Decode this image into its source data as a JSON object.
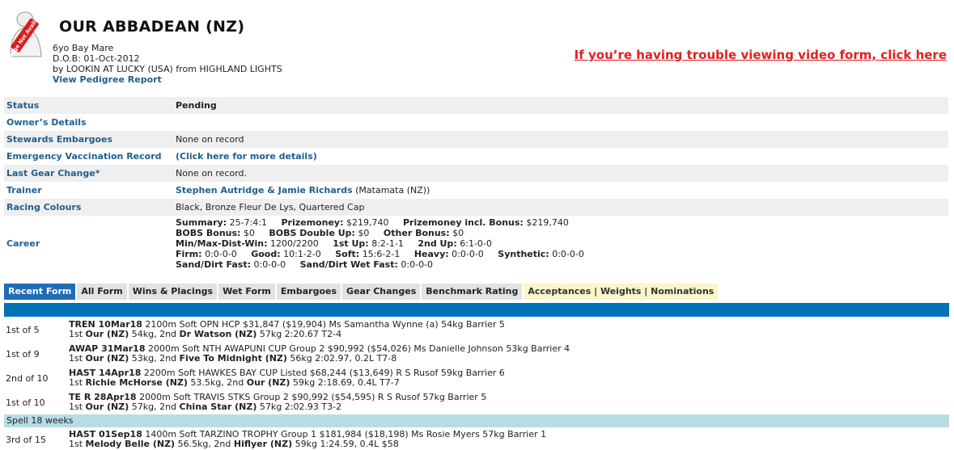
{
  "horse": {
    "name": "OUR ABBADEAN (NZ)",
    "image_alt": "Image Not Available",
    "age_sex": "6yo Bay Mare",
    "dob": "D.O.B: 01-Oct-2012",
    "sire_prefix": "by LOOKIN AT LUCKY (USA)  from HIGHLAND LIGHTS",
    "pedigree_link": "View Pedigree Report"
  },
  "video_link": "If you’re having trouble viewing video form, click here",
  "details": {
    "status_label": "Status",
    "status_value": "Pending",
    "owners_label": "Owner’s Details",
    "embargo_label": "Stewards Embargoes",
    "embargo_value": "None on record",
    "vacc_label": "Emergency Vaccination Record",
    "vacc_value": "(Click here for more details)",
    "gear_label": "Last Gear Change*",
    "gear_value": "None on record.",
    "trainer_label": "Trainer",
    "trainer_name": "Stephen Autridge & Jamie Richards",
    "trainer_loc": "(Matamata (NZ))",
    "colours_label": "Racing Colours",
    "colours_value": "Black, Bronze Fleur De Lys, Quartered Cap",
    "career_label": "Career"
  },
  "career": {
    "summary_k": "Summary:",
    "summary_v": "25-7:4:1",
    "prize_k": "Prizemoney:",
    "prize_v": "$219,740",
    "prizebonus_k": "Prizemoney incl. Bonus:",
    "prizebonus_v": "$219,740",
    "bobs_k": "BOBS Bonus:",
    "bobs_v": "$0",
    "bobsdouble_k": "BOBS Double Up:",
    "bobsdouble_v": "$0",
    "otherbonus_k": "Other Bonus:",
    "otherbonus_v": "$0",
    "mindist_k": "Min/Max-Dist-Win:",
    "mindist_v": "1200/2200",
    "firstup_k": "1st Up:",
    "firstup_v": "8:2-1-1",
    "secondup_k": "2nd Up:",
    "secondup_v": "6:1-0-0",
    "firm_k": "Firm:",
    "firm_v": "0:0-0-0",
    "good_k": "Good:",
    "good_v": "10:1-2-0",
    "soft_k": "Soft:",
    "soft_v": "15:6-2-1",
    "heavy_k": "Heavy:",
    "heavy_v": "0:0-0-0",
    "synth_k": "Synthetic:",
    "synth_v": "0:0-0-0",
    "sandfast_k": "Sand/Dirt Fast:",
    "sandfast_v": "0:0-0-0",
    "sandwet_k": "Sand/Dirt Wet Fast:",
    "sandwet_v": "0:0-0-0"
  },
  "tabs": [
    "Recent Form",
    "All Form",
    "Wins & Placings",
    "Wet Form",
    "Embargoes",
    "Gear Changes",
    "Benchmark Rating",
    "Acceptances | Weights | Nominations"
  ],
  "form": [
    {
      "pos": "1st of 5",
      "race": "TREN 10Mar18",
      "race_rest": " 2100m Soft OPN HCP $31,847 ($19,904) Ms Samantha Wynne (a) 54kg Barrier 5",
      "r1": "1st ",
      "h1": "Our (NZ)",
      "m1": " 54kg, 2nd ",
      "h2": "Dr Watson (NZ)",
      "m2": " 57kg 2:20.67 T2-4"
    },
    {
      "pos": "1st of 9",
      "race": "AWAP 31Mar18",
      "race_rest": " 2000m Soft NTH AWAPUNI CUP Group 2 $90,992 ($54,026) Ms Danielle Johnson 53kg Barrier 4",
      "r1": "1st ",
      "h1": "Our (NZ)",
      "m1": " 53kg, 2nd ",
      "h2": "Five To Midnight (NZ)",
      "m2": " 56kg 2:02.97, 0.2L T7-8"
    },
    {
      "pos": "2nd of 10",
      "race": "HAST 14Apr18",
      "race_rest": " 2200m Soft HAWKES BAY CUP Listed $68,244 ($13,649) R S Rusof 59kg Barrier 6",
      "r1": "1st ",
      "h1": "Richie McHorse (NZ)",
      "m1": " 53.5kg, 2nd ",
      "h2": "Our (NZ)",
      "m2": " 59kg 2:18.69, 0.4L T7-7"
    },
    {
      "pos": "1st of 10",
      "race": "TE R 28Apr18",
      "race_rest": " 2000m Soft TRAVIS STKS Group 2 $90,992 ($54,595) R S Rusof 57kg Barrier 5",
      "r1": "1st ",
      "h1": "Our (NZ)",
      "m1": " 57kg, 2nd ",
      "h2": "China Star (NZ)",
      "m2": " 57kg 2:02.93 T3-2"
    }
  ],
  "spell": "Spell 18 weeks",
  "form2": [
    {
      "pos": "3rd of 15",
      "race": "HAST 01Sep18",
      "race_rest": " 1400m Soft TARZINO TROPHY Group 1 $181,984 ($18,198) Ms Rosie Myers 57kg Barrier 1",
      "r1": "1st ",
      "h1": "Melody Belle (NZ)",
      "m1": " 56.5kg, 2nd ",
      "h2": "Hiflyer (NZ)",
      "m2": " 59kg 1:24.59, 0.4L $58"
    }
  ]
}
